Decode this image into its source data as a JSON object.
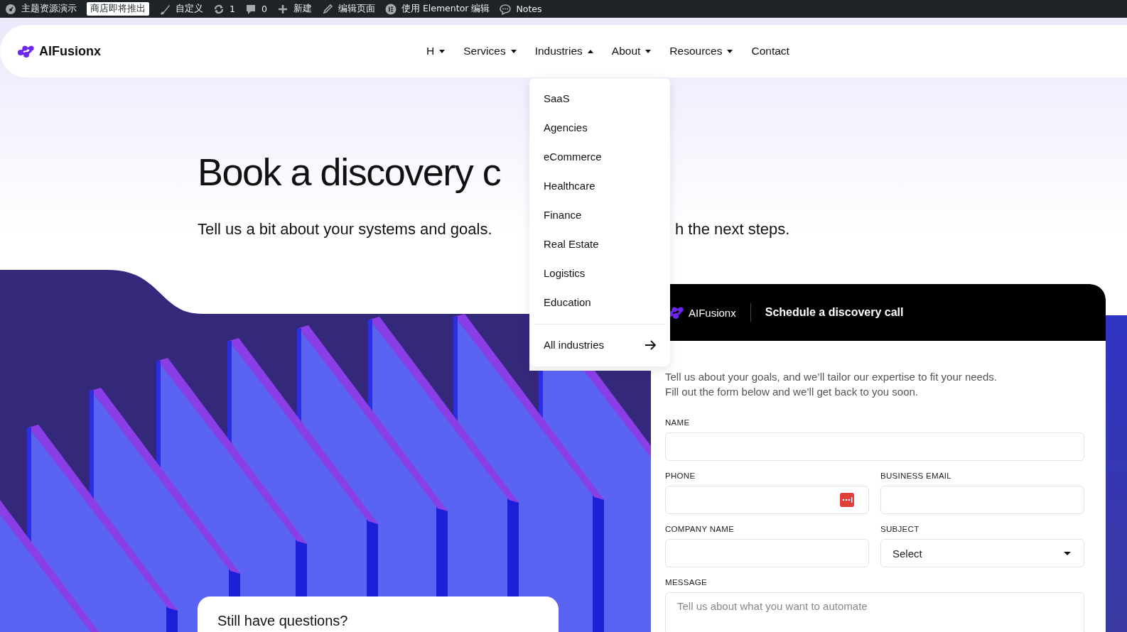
{
  "admin_bar": {
    "items": [
      {
        "kind": "site",
        "label": "主题资源演示"
      },
      {
        "kind": "badge",
        "label": "商店即将推出"
      },
      {
        "kind": "customize",
        "label": "自定义"
      },
      {
        "kind": "updates",
        "label": "1"
      },
      {
        "kind": "comments",
        "label": "0"
      },
      {
        "kind": "new",
        "label": "新建"
      },
      {
        "kind": "edit",
        "label": "编辑页面"
      },
      {
        "kind": "elementor",
        "label": "使用 Elementor 编辑"
      },
      {
        "kind": "notes",
        "label": "Notes"
      }
    ]
  },
  "header": {
    "logo": "AIFusionx",
    "nav": [
      {
        "label": "H",
        "has_menu": true,
        "expanded": false
      },
      {
        "label": "Services",
        "has_menu": true,
        "expanded": false
      },
      {
        "label": "Industries",
        "has_menu": true,
        "expanded": true
      },
      {
        "label": "About",
        "has_menu": true,
        "expanded": false
      },
      {
        "label": "Resources",
        "has_menu": true,
        "expanded": false
      },
      {
        "label": "Contact",
        "has_menu": false,
        "expanded": false
      }
    ]
  },
  "dropdown": {
    "items": [
      "SaaS",
      "Agencies",
      "eCommerce",
      "Healthcare",
      "Finance",
      "Real Estate",
      "Logistics",
      "Education"
    ],
    "footer": "All industries"
  },
  "hero": {
    "heading": "Book a discovery c",
    "subtitle_left": "Tell us a bit about your systems and goals.",
    "subtitle_right": "h the next steps."
  },
  "form": {
    "logo": "AIFusionx",
    "title": "Schedule a discovery call",
    "intro": [
      "Tell us about your goals, and we’ll tailor our expertise to fit your needs.",
      "Fill out the form below and we’ll get back to you soon."
    ],
    "fields": [
      {
        "label": "NAME",
        "kind": "text",
        "wide": true
      },
      {
        "label": "PHONE",
        "kind": "phone",
        "wide": false
      },
      {
        "label": "BUSINESS EMAIL",
        "kind": "text",
        "wide": false
      },
      {
        "label": "COMPANY NAME",
        "kind": "text",
        "wide": false
      },
      {
        "label": "SUBJECT",
        "kind": "select",
        "wide": false,
        "value": "Select"
      },
      {
        "label": "MESSAGE",
        "kind": "textarea",
        "wide": true,
        "placeholder": "Tell us about what you want to automate"
      }
    ]
  },
  "help_card": {
    "title": "Still have questions?"
  }
}
